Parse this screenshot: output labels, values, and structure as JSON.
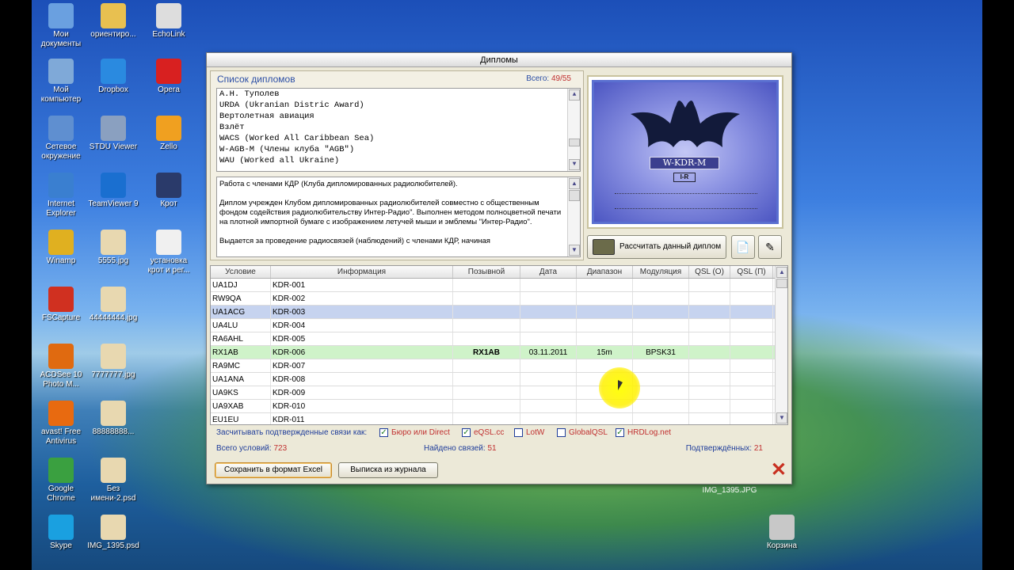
{
  "desktop": {
    "icons": [
      {
        "label": "Мои\nдокументы",
        "icon": "my-documents-icon"
      },
      {
        "label": "ориентиро...",
        "icon": "folder-icon"
      },
      {
        "label": "EchoLink",
        "icon": "antenna-icon"
      },
      {
        "label": "Мой\nкомпьютер",
        "icon": "computer-icon"
      },
      {
        "label": "Dropbox",
        "icon": "dropbox-icon"
      },
      {
        "label": "Opera",
        "icon": "opera-icon"
      },
      {
        "label": "Сетевое\nокружение",
        "icon": "network-icon"
      },
      {
        "label": "STDU Viewer",
        "icon": "stdu-viewer-icon"
      },
      {
        "label": "Zello",
        "icon": "zello-icon"
      },
      {
        "label": "Internet\nExplorer",
        "icon": "internet-explorer-icon"
      },
      {
        "label": "TeamViewer 9",
        "icon": "teamviewer-icon"
      },
      {
        "label": "Крот",
        "icon": "krot-icon"
      },
      {
        "label": "Winamp",
        "icon": "winamp-icon"
      },
      {
        "label": "5555.jpg",
        "icon": "jpg-file-icon"
      },
      {
        "label": "установка\nкрот и рег...",
        "icon": "document-icon"
      },
      {
        "label": "FSCapture",
        "icon": "fscapture-icon"
      },
      {
        "label": "44444444.jpg",
        "icon": "jpg-file-icon"
      },
      {
        "label": "ACDSee 10\nPhoto M...",
        "icon": "acdsee-icon"
      },
      {
        "label": "7777777.jpg",
        "icon": "jpg-file-icon"
      },
      {
        "label": "avast! Free\nAntivirus",
        "icon": "avast-icon"
      },
      {
        "label": "88888888...",
        "icon": "jpg-file-icon"
      },
      {
        "label": "Google\nChrome",
        "icon": "chrome-icon"
      },
      {
        "label": "Без\nимени-2.psd",
        "icon": "psd-file-icon"
      },
      {
        "label": "Skype",
        "icon": "skype-icon"
      },
      {
        "label": "IMG_1395.psd",
        "icon": "psd-file-icon"
      },
      {
        "label": "Корзина",
        "icon": "recycle-bin-icon"
      }
    ],
    "img_label": "IMG_1395.JPG"
  },
  "window": {
    "title": "Дипломы",
    "list_title": "Список дипломов",
    "count_label": "Всего:",
    "count_value": "49/55",
    "awards": [
      "А.Н. Туполев",
      "URDA (Ukranian Distric Award)",
      "Вертолетная авиация",
      "Взлёт",
      "WACS (Worked All Caribbean Sea)",
      "W-AGB-M (Члены клуба \"AGB\")",
      "WAU (Worked all Ukraine)"
    ],
    "description": [
      "Работа с членами КДР (Клуба дипломированных радиолюбителей).",
      "Диплом учрежден Клубом дипломированных радиолюбителей совместно с общественным фондом содействия радиолюбительству Интер-Радио\". Выполнен методом полноцветной печати на плотной импортной бумаге с изображением летучей мыши и эмблемы \"Интер-Радио\".",
      "Выдается за проведение радиосвязей (наблюдений) с членами КДР, начиная"
    ],
    "certificate_plate": "W-KDR-M",
    "certificate_logo": "I-R",
    "calc_button": "Рассчитать данный диплом",
    "table": {
      "headers": [
        "Условие",
        "Информация",
        "Позывной",
        "Дата",
        "Диапазон",
        "Модуляция",
        "QSL (О)",
        "QSL (П)"
      ],
      "rows": [
        [
          "UA1DJ",
          "KDR-001",
          "",
          "",
          "",
          "",
          "",
          ""
        ],
        [
          "RW9QA",
          "KDR-002",
          "",
          "",
          "",
          "",
          "",
          ""
        ],
        [
          "UA1ACG",
          "KDR-003",
          "",
          "",
          "",
          "",
          "",
          ""
        ],
        [
          "UA4LU",
          "KDR-004",
          "",
          "",
          "",
          "",
          "",
          ""
        ],
        [
          "RA6AHL",
          "KDR-005",
          "",
          "",
          "",
          "",
          "",
          ""
        ],
        [
          "RX1AB",
          "KDR-006",
          "RX1AB",
          "03.11.2011",
          "15m",
          "BPSK31",
          "",
          ""
        ],
        [
          "RA9MC",
          "KDR-007",
          "",
          "",
          "",
          "",
          "",
          ""
        ],
        [
          "UA1ANA",
          "KDR-008",
          "",
          "",
          "",
          "",
          "",
          ""
        ],
        [
          "UA9KS",
          "KDR-009",
          "",
          "",
          "",
          "",
          "",
          ""
        ],
        [
          "UA9XAB",
          "KDR-010",
          "",
          "",
          "",
          "",
          "",
          ""
        ],
        [
          "EU1EU",
          "KDR-011",
          "",
          "",
          "",
          "",
          "",
          ""
        ]
      ],
      "selected_row": 2,
      "confirmed_row": 5
    },
    "options": {
      "label": "Засчитывать подтвержденные связи как:",
      "checks": [
        {
          "label": "Бюро или Direct",
          "checked": true
        },
        {
          "label": "eQSL.cc",
          "checked": true
        },
        {
          "label": "LotW",
          "checked": false
        },
        {
          "label": "GlobalQSL",
          "checked": false
        },
        {
          "label": "HRDLog.net",
          "checked": true
        }
      ]
    },
    "stats": {
      "total_label": "Всего условий:",
      "total_value": "723",
      "found_label": "Найдено связей:",
      "found_value": "51",
      "confirmed_label": "Подтверждённых:",
      "confirmed_value": "21"
    },
    "buttons": {
      "save_excel": "Сохранить в формат  Excel",
      "journal": "Выписка из журнала"
    }
  }
}
